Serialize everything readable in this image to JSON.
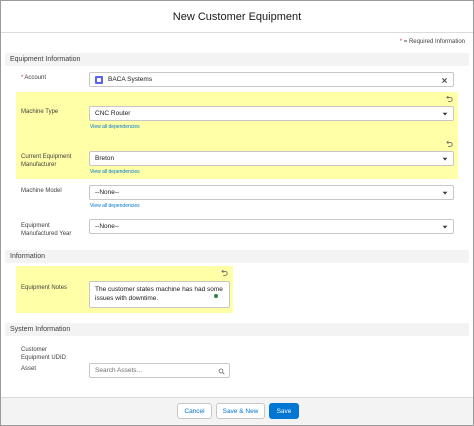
{
  "modal": {
    "title": "New Customer Equipment",
    "required_star": "*",
    "required_note": "= Required Information"
  },
  "sections": {
    "equipment_information": "Equipment Information",
    "information": "Information",
    "system_information": "System Information"
  },
  "fields": {
    "account": {
      "required_star": "*",
      "label": "Account",
      "value": "BACA Systems",
      "icon": "account-icon"
    },
    "machine_type": {
      "label": "Machine Type",
      "value": "CNC Router",
      "deps_link": "View all dependencies"
    },
    "current_equipment_manufacturer": {
      "label_line1": "Current Equipment",
      "label_line2": "Manufacturer",
      "value": "Breton",
      "deps_link": "View all dependencies"
    },
    "machine_model": {
      "label": "Machine Model",
      "value": "--None--",
      "deps_link": "View all dependencies"
    },
    "equipment_manufactured_year": {
      "label_line1": "Equipment",
      "label_line2": "Manufactured Year",
      "value": "--None--"
    },
    "equipment_notes": {
      "label": "Equipment Notes",
      "value": "The customer states machine has had some issues with downtime."
    },
    "customer_equipment_udid": {
      "label_line1": "Customer",
      "label_line2": "Equipment UDID"
    },
    "asset": {
      "label": "Asset",
      "placeholder": "Search Assets..."
    }
  },
  "footer": {
    "cancel_label": "Cancel",
    "save_new_label": "Save & New",
    "save_label": "Save"
  },
  "colors": {
    "highlight": "#ffff99",
    "brand": "#0176d3",
    "required": "#c23934",
    "lookup_icon": "#5867e8"
  }
}
